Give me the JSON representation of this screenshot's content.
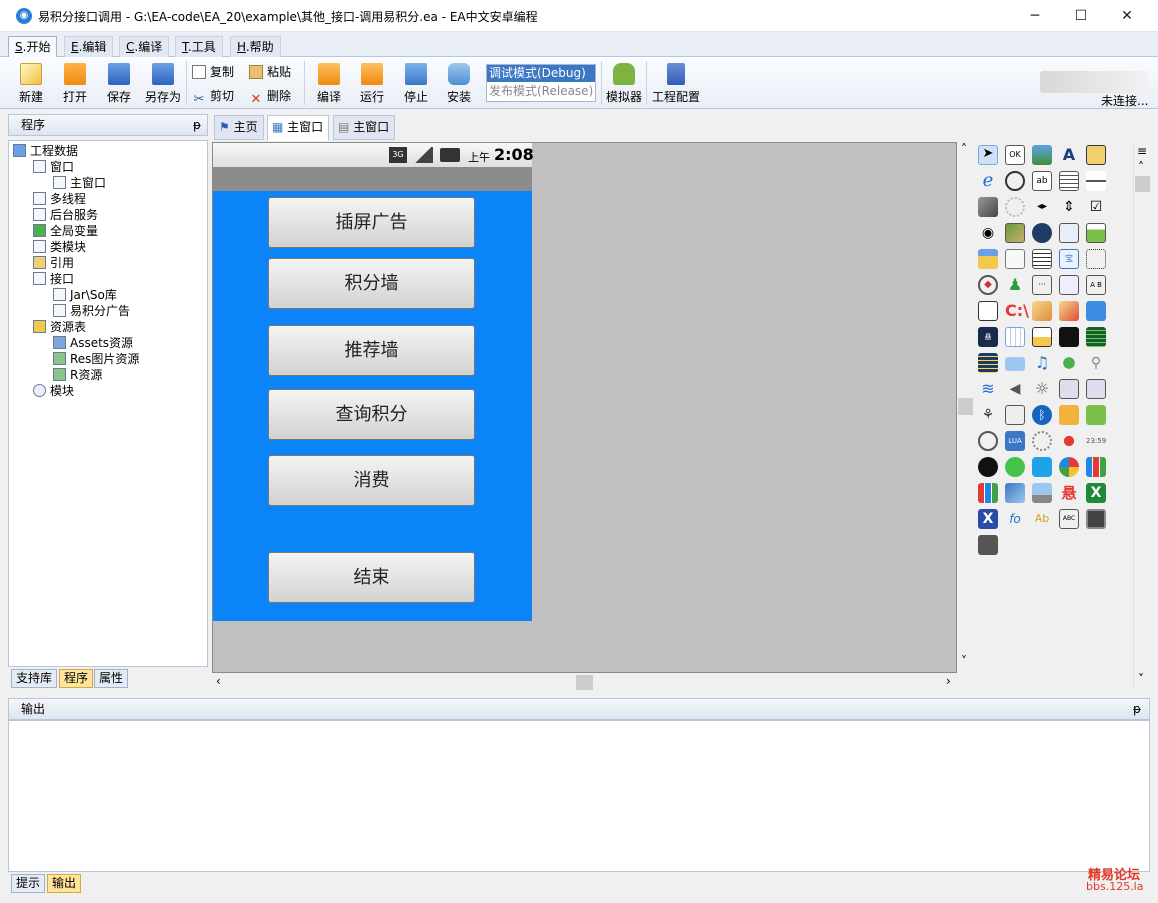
{
  "window": {
    "title": "易积分接口调用 - G:\\EA-code\\EA_20\\example\\其他_接口-调用易积分.ea - EA中文安卓编程",
    "minimize": "─",
    "maximize": "☐",
    "close": "✕"
  },
  "menu_tabs": [
    {
      "key": "S",
      "label": ".开始"
    },
    {
      "key": "E",
      "label": ".编辑"
    },
    {
      "key": "C",
      "label": ".编译"
    },
    {
      "key": "T",
      "label": ".工具"
    },
    {
      "key": "H",
      "label": ".帮助"
    }
  ],
  "toolbar": {
    "new": "新建",
    "open": "打开",
    "save": "保存",
    "save_as": "另存为",
    "copy": "复制",
    "paste": "粘贴",
    "cut": "剪切",
    "delete": "删除",
    "compile": "编译",
    "run": "运行",
    "stop": "停止",
    "install": "安装",
    "mode_debug": "调试模式(Debug)",
    "mode_release": "发布模式(Release)",
    "emulator": "模拟器",
    "project_config": "工程配置",
    "connection_status": "未连接..."
  },
  "left_panel": {
    "title": "程序",
    "pin": "ᵽ",
    "tree": [
      {
        "label": "工程数据",
        "level": 0
      },
      {
        "label": "窗口",
        "level": 1
      },
      {
        "label": "主窗口",
        "level": 2
      },
      {
        "label": "多线程",
        "level": 1
      },
      {
        "label": "后台服务",
        "level": 1
      },
      {
        "label": "全局变量",
        "level": 1
      },
      {
        "label": "类模块",
        "level": 1
      },
      {
        "label": "引用",
        "level": 1
      },
      {
        "label": "接口",
        "level": 1
      },
      {
        "label": "Jar\\So库",
        "level": 2
      },
      {
        "label": "易积分广告",
        "level": 2
      },
      {
        "label": "资源表",
        "level": 1
      },
      {
        "label": "Assets资源",
        "level": 2
      },
      {
        "label": "Res图片资源",
        "level": 2
      },
      {
        "label": "R资源",
        "level": 2
      },
      {
        "label": "模块",
        "level": 1
      }
    ],
    "tabs": [
      "支持库",
      "程序",
      "属性"
    ]
  },
  "editor_tabs": [
    "主页",
    "主窗口",
    "主窗口"
  ],
  "phone": {
    "network": "3G",
    "time_prefix": "上午",
    "time": "2:08",
    "buttons": [
      "插屏广告",
      "积分墙",
      "推荐墙",
      "查询积分",
      "消费",
      "结束"
    ]
  },
  "palette": {
    "text_items": [
      "OK",
      "A",
      "ab",
      "宝",
      "C:\\",
      "悬",
      "X",
      "X",
      "Ab",
      "ABC",
      "LUA",
      "23:59"
    ]
  },
  "output_panel": {
    "title": "输出",
    "pin": "ᵽ",
    "tabs": [
      "提示",
      "输出"
    ]
  },
  "watermark": {
    "line1": "精易论坛",
    "line2": "bbs.125.la"
  },
  "colors": {
    "phone_background": "#0a84f6",
    "accent": "#3a77c4"
  }
}
